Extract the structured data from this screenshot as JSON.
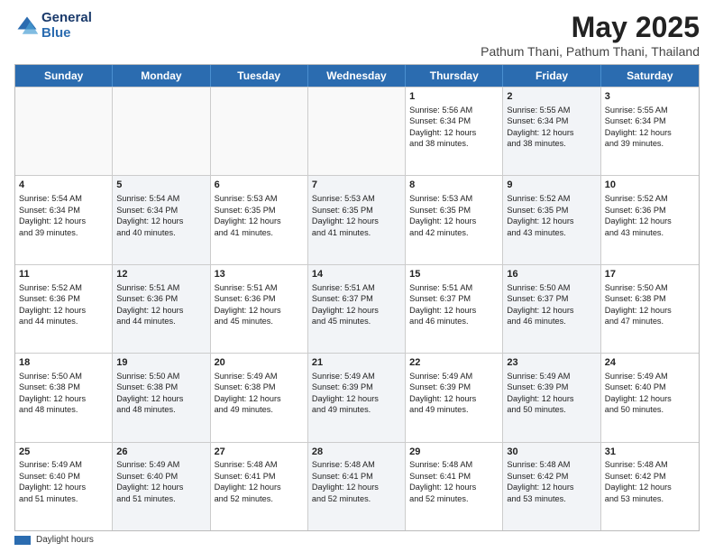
{
  "header": {
    "logo_line1": "General",
    "logo_line2": "Blue",
    "title": "May 2025",
    "subtitle": "Pathum Thani, Pathum Thani, Thailand"
  },
  "days_of_week": [
    "Sunday",
    "Monday",
    "Tuesday",
    "Wednesday",
    "Thursday",
    "Friday",
    "Saturday"
  ],
  "weeks": [
    [
      {
        "day": "",
        "info": "",
        "shaded": false
      },
      {
        "day": "",
        "info": "",
        "shaded": false
      },
      {
        "day": "",
        "info": "",
        "shaded": false
      },
      {
        "day": "",
        "info": "",
        "shaded": false
      },
      {
        "day": "1",
        "info": "Sunrise: 5:56 AM\nSunset: 6:34 PM\nDaylight: 12 hours\nand 38 minutes.",
        "shaded": false
      },
      {
        "day": "2",
        "info": "Sunrise: 5:55 AM\nSunset: 6:34 PM\nDaylight: 12 hours\nand 38 minutes.",
        "shaded": true
      },
      {
        "day": "3",
        "info": "Sunrise: 5:55 AM\nSunset: 6:34 PM\nDaylight: 12 hours\nand 39 minutes.",
        "shaded": false
      }
    ],
    [
      {
        "day": "4",
        "info": "Sunrise: 5:54 AM\nSunset: 6:34 PM\nDaylight: 12 hours\nand 39 minutes.",
        "shaded": false
      },
      {
        "day": "5",
        "info": "Sunrise: 5:54 AM\nSunset: 6:34 PM\nDaylight: 12 hours\nand 40 minutes.",
        "shaded": true
      },
      {
        "day": "6",
        "info": "Sunrise: 5:53 AM\nSunset: 6:35 PM\nDaylight: 12 hours\nand 41 minutes.",
        "shaded": false
      },
      {
        "day": "7",
        "info": "Sunrise: 5:53 AM\nSunset: 6:35 PM\nDaylight: 12 hours\nand 41 minutes.",
        "shaded": true
      },
      {
        "day": "8",
        "info": "Sunrise: 5:53 AM\nSunset: 6:35 PM\nDaylight: 12 hours\nand 42 minutes.",
        "shaded": false
      },
      {
        "day": "9",
        "info": "Sunrise: 5:52 AM\nSunset: 6:35 PM\nDaylight: 12 hours\nand 43 minutes.",
        "shaded": true
      },
      {
        "day": "10",
        "info": "Sunrise: 5:52 AM\nSunset: 6:36 PM\nDaylight: 12 hours\nand 43 minutes.",
        "shaded": false
      }
    ],
    [
      {
        "day": "11",
        "info": "Sunrise: 5:52 AM\nSunset: 6:36 PM\nDaylight: 12 hours\nand 44 minutes.",
        "shaded": false
      },
      {
        "day": "12",
        "info": "Sunrise: 5:51 AM\nSunset: 6:36 PM\nDaylight: 12 hours\nand 44 minutes.",
        "shaded": true
      },
      {
        "day": "13",
        "info": "Sunrise: 5:51 AM\nSunset: 6:36 PM\nDaylight: 12 hours\nand 45 minutes.",
        "shaded": false
      },
      {
        "day": "14",
        "info": "Sunrise: 5:51 AM\nSunset: 6:37 PM\nDaylight: 12 hours\nand 45 minutes.",
        "shaded": true
      },
      {
        "day": "15",
        "info": "Sunrise: 5:51 AM\nSunset: 6:37 PM\nDaylight: 12 hours\nand 46 minutes.",
        "shaded": false
      },
      {
        "day": "16",
        "info": "Sunrise: 5:50 AM\nSunset: 6:37 PM\nDaylight: 12 hours\nand 46 minutes.",
        "shaded": true
      },
      {
        "day": "17",
        "info": "Sunrise: 5:50 AM\nSunset: 6:38 PM\nDaylight: 12 hours\nand 47 minutes.",
        "shaded": false
      }
    ],
    [
      {
        "day": "18",
        "info": "Sunrise: 5:50 AM\nSunset: 6:38 PM\nDaylight: 12 hours\nand 48 minutes.",
        "shaded": false
      },
      {
        "day": "19",
        "info": "Sunrise: 5:50 AM\nSunset: 6:38 PM\nDaylight: 12 hours\nand 48 minutes.",
        "shaded": true
      },
      {
        "day": "20",
        "info": "Sunrise: 5:49 AM\nSunset: 6:38 PM\nDaylight: 12 hours\nand 49 minutes.",
        "shaded": false
      },
      {
        "day": "21",
        "info": "Sunrise: 5:49 AM\nSunset: 6:39 PM\nDaylight: 12 hours\nand 49 minutes.",
        "shaded": true
      },
      {
        "day": "22",
        "info": "Sunrise: 5:49 AM\nSunset: 6:39 PM\nDaylight: 12 hours\nand 49 minutes.",
        "shaded": false
      },
      {
        "day": "23",
        "info": "Sunrise: 5:49 AM\nSunset: 6:39 PM\nDaylight: 12 hours\nand 50 minutes.",
        "shaded": true
      },
      {
        "day": "24",
        "info": "Sunrise: 5:49 AM\nSunset: 6:40 PM\nDaylight: 12 hours\nand 50 minutes.",
        "shaded": false
      }
    ],
    [
      {
        "day": "25",
        "info": "Sunrise: 5:49 AM\nSunset: 6:40 PM\nDaylight: 12 hours\nand 51 minutes.",
        "shaded": false
      },
      {
        "day": "26",
        "info": "Sunrise: 5:49 AM\nSunset: 6:40 PM\nDaylight: 12 hours\nand 51 minutes.",
        "shaded": true
      },
      {
        "day": "27",
        "info": "Sunrise: 5:48 AM\nSunset: 6:41 PM\nDaylight: 12 hours\nand 52 minutes.",
        "shaded": false
      },
      {
        "day": "28",
        "info": "Sunrise: 5:48 AM\nSunset: 6:41 PM\nDaylight: 12 hours\nand 52 minutes.",
        "shaded": true
      },
      {
        "day": "29",
        "info": "Sunrise: 5:48 AM\nSunset: 6:41 PM\nDaylight: 12 hours\nand 52 minutes.",
        "shaded": false
      },
      {
        "day": "30",
        "info": "Sunrise: 5:48 AM\nSunset: 6:42 PM\nDaylight: 12 hours\nand 53 minutes.",
        "shaded": true
      },
      {
        "day": "31",
        "info": "Sunrise: 5:48 AM\nSunset: 6:42 PM\nDaylight: 12 hours\nand 53 minutes.",
        "shaded": false
      }
    ]
  ],
  "legend": {
    "bar_label": "Daylight hours"
  }
}
